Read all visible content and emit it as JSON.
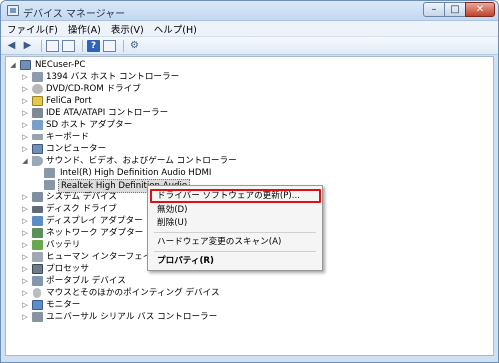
{
  "window": {
    "title": "デバイス マネージャー",
    "min": "–",
    "max": "□",
    "close": "✕"
  },
  "menu": [
    "ファイル(F)",
    "操作(A)",
    "表示(V)",
    "ヘルプ(H)"
  ],
  "toolbar": {
    "help": "?"
  },
  "tree": {
    "root": "NECuser-PC",
    "items": [
      {
        "label": "1394 バス ホスト コントローラー",
        "icon": "1394-controller-icon",
        "expanded": false
      },
      {
        "label": "DVD/CD-ROM ドライブ",
        "icon": "disc-drive-icon",
        "expanded": false
      },
      {
        "label": "FeliCa Port",
        "icon": "felica-icon",
        "expanded": false
      },
      {
        "label": "IDE ATA/ATAPI コントローラー",
        "icon": "ide-controller-icon",
        "expanded": false
      },
      {
        "label": "SD ホスト アダプター",
        "icon": "sd-adapter-icon",
        "expanded": false
      },
      {
        "label": "キーボード",
        "icon": "keyboard-icon",
        "expanded": false
      },
      {
        "label": "コンピューター",
        "icon": "computer-icon",
        "expanded": false
      },
      {
        "label": "サウンド、ビデオ、およびゲーム コントローラー",
        "icon": "sound-icon",
        "expanded": true,
        "children": [
          "Intel(R) High Definition Audio HDMI",
          "Realtek High Definition Audio"
        ]
      },
      {
        "label": "システム デバイス",
        "icon": "system-device-icon",
        "expanded": false
      },
      {
        "label": "ディスク ドライブ",
        "icon": "disk-drive-icon",
        "expanded": false
      },
      {
        "label": "ディスプレイ アダプター",
        "icon": "display-adapter-icon",
        "expanded": false
      },
      {
        "label": "ネットワーク アダプター",
        "icon": "network-adapter-icon",
        "expanded": false
      },
      {
        "label": "バッテリ",
        "icon": "battery-icon",
        "expanded": false
      },
      {
        "label": "ヒューマン インターフェイス デバイス",
        "icon": "hid-icon",
        "expanded": false
      },
      {
        "label": "プロセッサ",
        "icon": "processor-icon",
        "expanded": false
      },
      {
        "label": "ポータブル デバイス",
        "icon": "portable-device-icon",
        "expanded": false
      },
      {
        "label": "マウスとそのほかのポインティング デバイス",
        "icon": "mouse-icon",
        "expanded": false
      },
      {
        "label": "モニター",
        "icon": "monitor-icon",
        "expanded": false
      },
      {
        "label": "ユニバーサル シリアル バス コントローラー",
        "icon": "usb-icon",
        "expanded": false
      }
    ]
  },
  "context_menu": {
    "update": "ドライバー ソフトウェアの更新(P)...",
    "disable": "無効(D)",
    "uninstall": "削除(U)",
    "scan": "ハードウェア変更のスキャン(A)",
    "properties": "プロパティ(R)"
  },
  "colors": {
    "highlight": "#e01010",
    "title_bar": "#c3d8ef"
  }
}
